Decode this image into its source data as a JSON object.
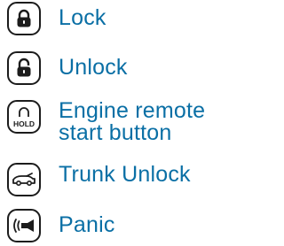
{
  "accent_color": "#0a6fa5",
  "icon_color": "#1c1c1c",
  "buttons": [
    {
      "id": "lock",
      "icon": "padlock-closed-icon",
      "label": "Lock"
    },
    {
      "id": "unlock",
      "icon": "padlock-open-icon",
      "label": "Unlock"
    },
    {
      "id": "engine",
      "icon": "engine-remote-start-hold-icon",
      "icon_text": "HOLD",
      "label": "Engine remote\nstart button"
    },
    {
      "id": "trunk",
      "icon": "car-trunk-icon",
      "label": "Trunk Unlock"
    },
    {
      "id": "panic",
      "icon": "horn-icon",
      "label": "Panic"
    }
  ]
}
